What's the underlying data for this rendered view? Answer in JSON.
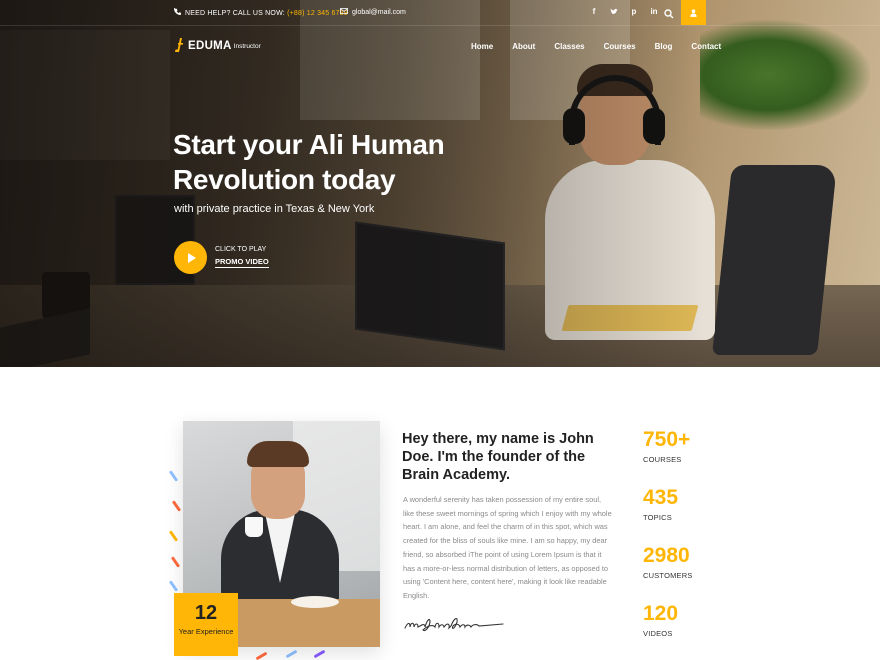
{
  "colors": {
    "accent": "#ffb606",
    "heading": "#222222",
    "body_text": "#8a8a8a"
  },
  "topbar": {
    "help_prefix": "NEED HELP? CALL US NOW: ",
    "phone": "(+88) 12 345 6789",
    "email": "global@mail.com",
    "social_icons": [
      "facebook-icon",
      "twitter-icon",
      "pinterest-icon",
      "linkedin-icon"
    ],
    "search_icon": "search-icon",
    "user_icon": "user-icon"
  },
  "header": {
    "brand": "EDUMA",
    "brand_sub": "Instructor",
    "nav": [
      "Home",
      "About",
      "Classes",
      "Courses",
      "Blog",
      "Contact"
    ]
  },
  "hero": {
    "title": "Start your Ali Human Revolution today",
    "subtitle": "with private practice in Texas & New York",
    "play_small": "CLICK TO PLAY",
    "play_label": "PROMO VIDEO"
  },
  "about": {
    "title": "Hey there, my name is John Doe. I'm the founder of the Brain Academy.",
    "text": "A wonderful serenity has taken possession of my entire soul, like these sweet mornings of spring which I enjoy with my whole heart. I am alone, and feel the charm of  in this spot, which was created for the bliss of souls like mine. I am so happy, my dear friend, so absorbed iThe point of using Lorem Ipsum is that it has a more-or-less normal distribution of letters, as opposed to using 'Content here, content here', making it look like readable English.",
    "experience_value": "12",
    "experience_label": "Year Experience"
  },
  "stats": [
    {
      "value": "750+",
      "label": "COURSES"
    },
    {
      "value": "435",
      "label": "TOPICS"
    },
    {
      "value": "2980",
      "label": "CUSTOMERS"
    },
    {
      "value": "120",
      "label": "VIDEOS"
    }
  ]
}
